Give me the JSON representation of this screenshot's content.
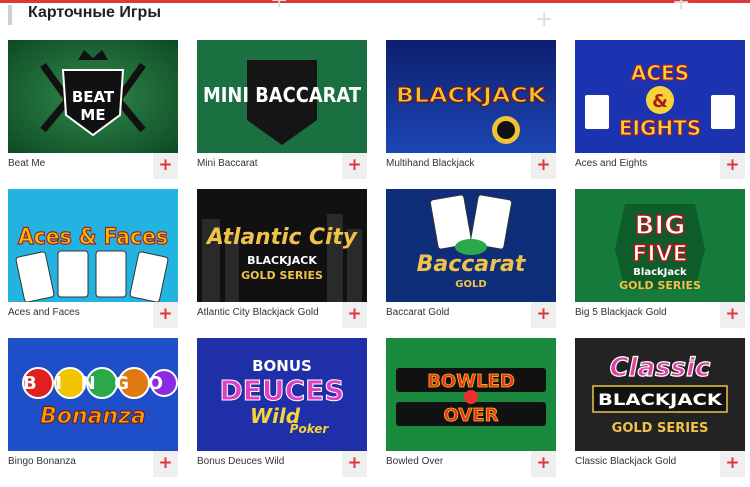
{
  "section": {
    "title": "Карточные Игры"
  },
  "games": [
    {
      "name": "Beat Me",
      "logo": "BEAT ME"
    },
    {
      "name": "Mini Baccarat",
      "logo": "MINI BACCARAT"
    },
    {
      "name": "Multihand Blackjack",
      "logo": "BLACKJACK"
    },
    {
      "name": "Aces and Eights",
      "logo": "ACES & EIGHTS"
    },
    {
      "name": "Aces and Faces",
      "logo": "Aces & Faces"
    },
    {
      "name": "Atlantic City Blackjack Gold",
      "logo": "Atlantic City"
    },
    {
      "name": "Baccarat Gold",
      "logo": "Baccarat"
    },
    {
      "name": "Big 5 Blackjack Gold",
      "logo": "BIG FIVE"
    },
    {
      "name": "Bingo Bonanza",
      "logo": "BINGO Bonanza"
    },
    {
      "name": "Bonus Deuces Wild",
      "logo": "BONUS DEUCES"
    },
    {
      "name": "Bowled Over",
      "logo": "BOWLED OVER"
    },
    {
      "name": "Classic Blackjack Gold",
      "logo": "Classic BLACKJACK"
    }
  ],
  "add_button": {
    "label": "+",
    "icon": "plus-icon"
  },
  "colors": {
    "accent": "#e2363b",
    "green_felt": "#1f7a3c",
    "blue_felt": "#1b2fa8"
  }
}
